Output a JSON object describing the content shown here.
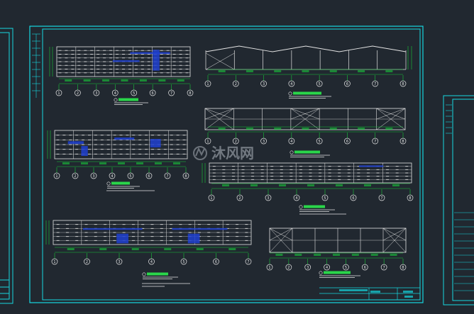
{
  "watermark": {
    "text": "沐风网",
    "logo": "M"
  },
  "colors": {
    "background": "#212830",
    "frame": "#16d7e0",
    "structure": "#e4e4e4",
    "dimension": "#18c83a",
    "axis": "#e8e8e8",
    "fill": "#1f3fd0",
    "label_bar": "#2ad64a"
  },
  "axis_labels": {
    "row1_left": [
      "1",
      "2",
      "3",
      "4",
      "5",
      "6",
      "7",
      "8"
    ],
    "row1_right": [
      "1",
      "2",
      "3",
      "4",
      "5",
      "6",
      "7",
      "8"
    ],
    "row2_left": [
      "1",
      "2",
      "3",
      "4",
      "5",
      "6",
      "7",
      "8"
    ],
    "row2_right": [
      "1",
      "2",
      "3",
      "4",
      "5",
      "6",
      "7",
      "8"
    ],
    "row2b_right": [
      "1",
      "2",
      "3",
      "4",
      "5",
      "6",
      "7",
      "8"
    ],
    "row3_left": [
      "1",
      "2",
      "3",
      "4",
      "5",
      "6",
      "7"
    ],
    "row3_right": [
      "1",
      "2",
      "3",
      "4",
      "5",
      "6",
      "7",
      "8"
    ]
  }
}
